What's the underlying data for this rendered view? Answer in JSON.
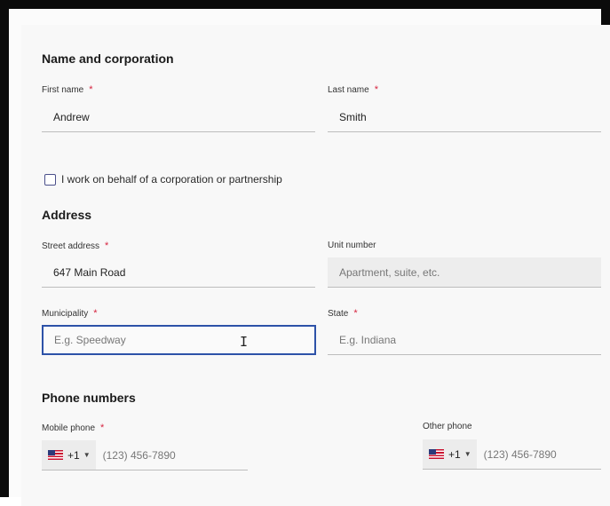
{
  "sections": {
    "name": "Name and corporation",
    "address": "Address",
    "phones": "Phone numbers"
  },
  "required_mark": "*",
  "first_name": {
    "label": "First name",
    "value": "Andrew"
  },
  "last_name": {
    "label": "Last name",
    "value": "Smith"
  },
  "corporation_checkbox": {
    "label": "I work on behalf of a corporation or partnership",
    "checked": false
  },
  "street_address": {
    "label": "Street address",
    "value": "647 Main Road"
  },
  "unit_number": {
    "label": "Unit number",
    "placeholder": "Apartment, suite, etc."
  },
  "municipality": {
    "label": "Municipality",
    "placeholder": "E.g. Speedway"
  },
  "state": {
    "label": "State",
    "placeholder": "E.g. Indiana"
  },
  "mobile_phone": {
    "label": "Mobile phone",
    "country_code": "+1",
    "placeholder": "(123) 456-7890"
  },
  "other_phone": {
    "label": "Other phone",
    "country_code": "+1",
    "placeholder": "(123) 456-7890"
  },
  "colors": {
    "required": "#d6243f",
    "focus": "#2d52a8"
  }
}
